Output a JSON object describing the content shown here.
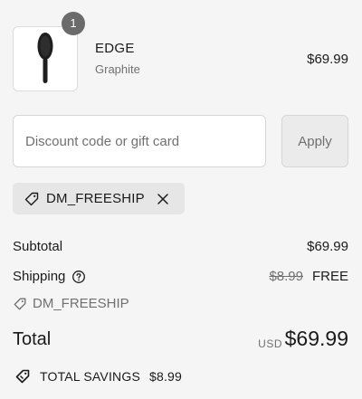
{
  "product": {
    "quantity": "1",
    "name": "EDGE",
    "variant": "Graphite",
    "price": "$69.99"
  },
  "discount": {
    "placeholder": "Discount code or gift card",
    "value": "",
    "apply_label": "Apply",
    "applied_code": "DM_FREESHIP"
  },
  "totals": {
    "subtotal_label": "Subtotal",
    "subtotal_value": "$69.99",
    "shipping_label": "Shipping",
    "shipping_original": "$8.99",
    "shipping_value": "FREE",
    "shipping_code": "DM_FREESHIP",
    "total_label": "Total",
    "currency": "USD",
    "total_value": "$69.99",
    "savings_label": "TOTAL SAVINGS",
    "savings_value": "$8.99"
  },
  "icons": {
    "product_image": "hairbrush-image",
    "tag": "tag-icon",
    "remove": "close-icon",
    "help": "question-circle-icon",
    "savings": "tag-icon"
  }
}
